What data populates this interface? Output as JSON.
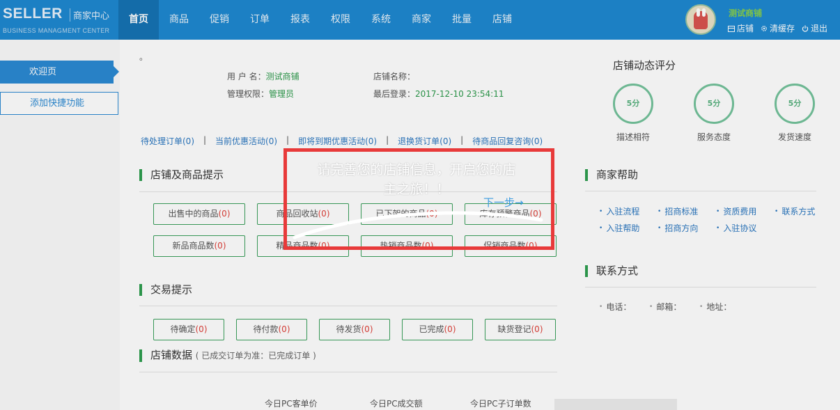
{
  "header": {
    "logo_main": "SELLER",
    "logo_cn": "商家中心",
    "logo_sub": "BUSINESS MANAGMENT CENTER",
    "nav": [
      {
        "label": "首页",
        "active": true
      },
      {
        "label": "商品"
      },
      {
        "label": "促销"
      },
      {
        "label": "订单"
      },
      {
        "label": "报表"
      },
      {
        "label": "权限"
      },
      {
        "label": "系统"
      },
      {
        "label": "商家"
      },
      {
        "label": "批量"
      },
      {
        "label": "店铺"
      }
    ],
    "shop_name": "测试商铺",
    "links": {
      "shop": "店铺",
      "clear_cache": "清缓存",
      "logout": "退出"
    }
  },
  "sidebar": {
    "active": "欢迎页",
    "add_shortcut": "添加快捷功能"
  },
  "account": {
    "dot": "。",
    "username_label": "用 户 名：",
    "username": "测试商铺",
    "role_label": "管理权限：",
    "role": "管理员",
    "store_name_label": "店铺名称：",
    "store_name": "",
    "last_login_label": "最后登录：",
    "last_login": "2017-12-10 23:54:11"
  },
  "quick_links": [
    "待处理订单(0)",
    "当前优惠活动(0)",
    "即将到期优惠活动(0)",
    "退换货订单(0)",
    "待商品回复咨询(0)"
  ],
  "goods_section": {
    "title": "店铺及商品提示",
    "buttons": [
      {
        "label": "出售中的商品",
        "count": "(0)"
      },
      {
        "label": "商品回收站",
        "count": "(0)"
      },
      {
        "label": "已下架的商品",
        "count": "(0)"
      },
      {
        "label": "库存预警商品",
        "count": "(0)"
      },
      {
        "label": "新品商品数",
        "count": "(0)"
      },
      {
        "label": "精品商品数",
        "count": "(0)"
      },
      {
        "label": "热销商品数",
        "count": "(0)"
      },
      {
        "label": "促销商品数",
        "count": "(0)"
      }
    ]
  },
  "trade_section": {
    "title": "交易提示",
    "buttons": [
      {
        "label": "待确定",
        "count": "(0)"
      },
      {
        "label": "待付款",
        "count": "(0)"
      },
      {
        "label": "待发货",
        "count": "(0)"
      },
      {
        "label": "已完成",
        "count": "(0)"
      },
      {
        "label": "缺货登记",
        "count": "(0)"
      }
    ]
  },
  "data_section": {
    "title": "店铺数据",
    "note": "( 已成交订单为准：已完成订单 )",
    "stats": [
      "今日PC客单价",
      "今日PC成交额",
      "今日PC子订单数"
    ]
  },
  "rating": {
    "title": "店铺动态评分",
    "items": [
      {
        "score": "5分",
        "label": "描述相符"
      },
      {
        "score": "5分",
        "label": "服务态度"
      },
      {
        "score": "5分",
        "label": "发货速度"
      }
    ]
  },
  "help": {
    "title": "商家帮助",
    "links": [
      "入驻流程",
      "招商标准",
      "资质费用",
      "联系方式",
      "入驻帮助",
      "招商方向",
      "入驻协议"
    ]
  },
  "contact": {
    "title": "联系方式",
    "phone": "电话：",
    "email": "邮箱：",
    "address": "地址："
  },
  "guide": {
    "line1": "请完善您的店铺信息，开启您的店",
    "line2": "主之旅！！",
    "next": "下一步→"
  },
  "colors": {
    "header": "#1e88d1",
    "accent_green": "#2e9e4f",
    "link_blue": "#2b78c1",
    "guide_border": "#e83a3a"
  }
}
